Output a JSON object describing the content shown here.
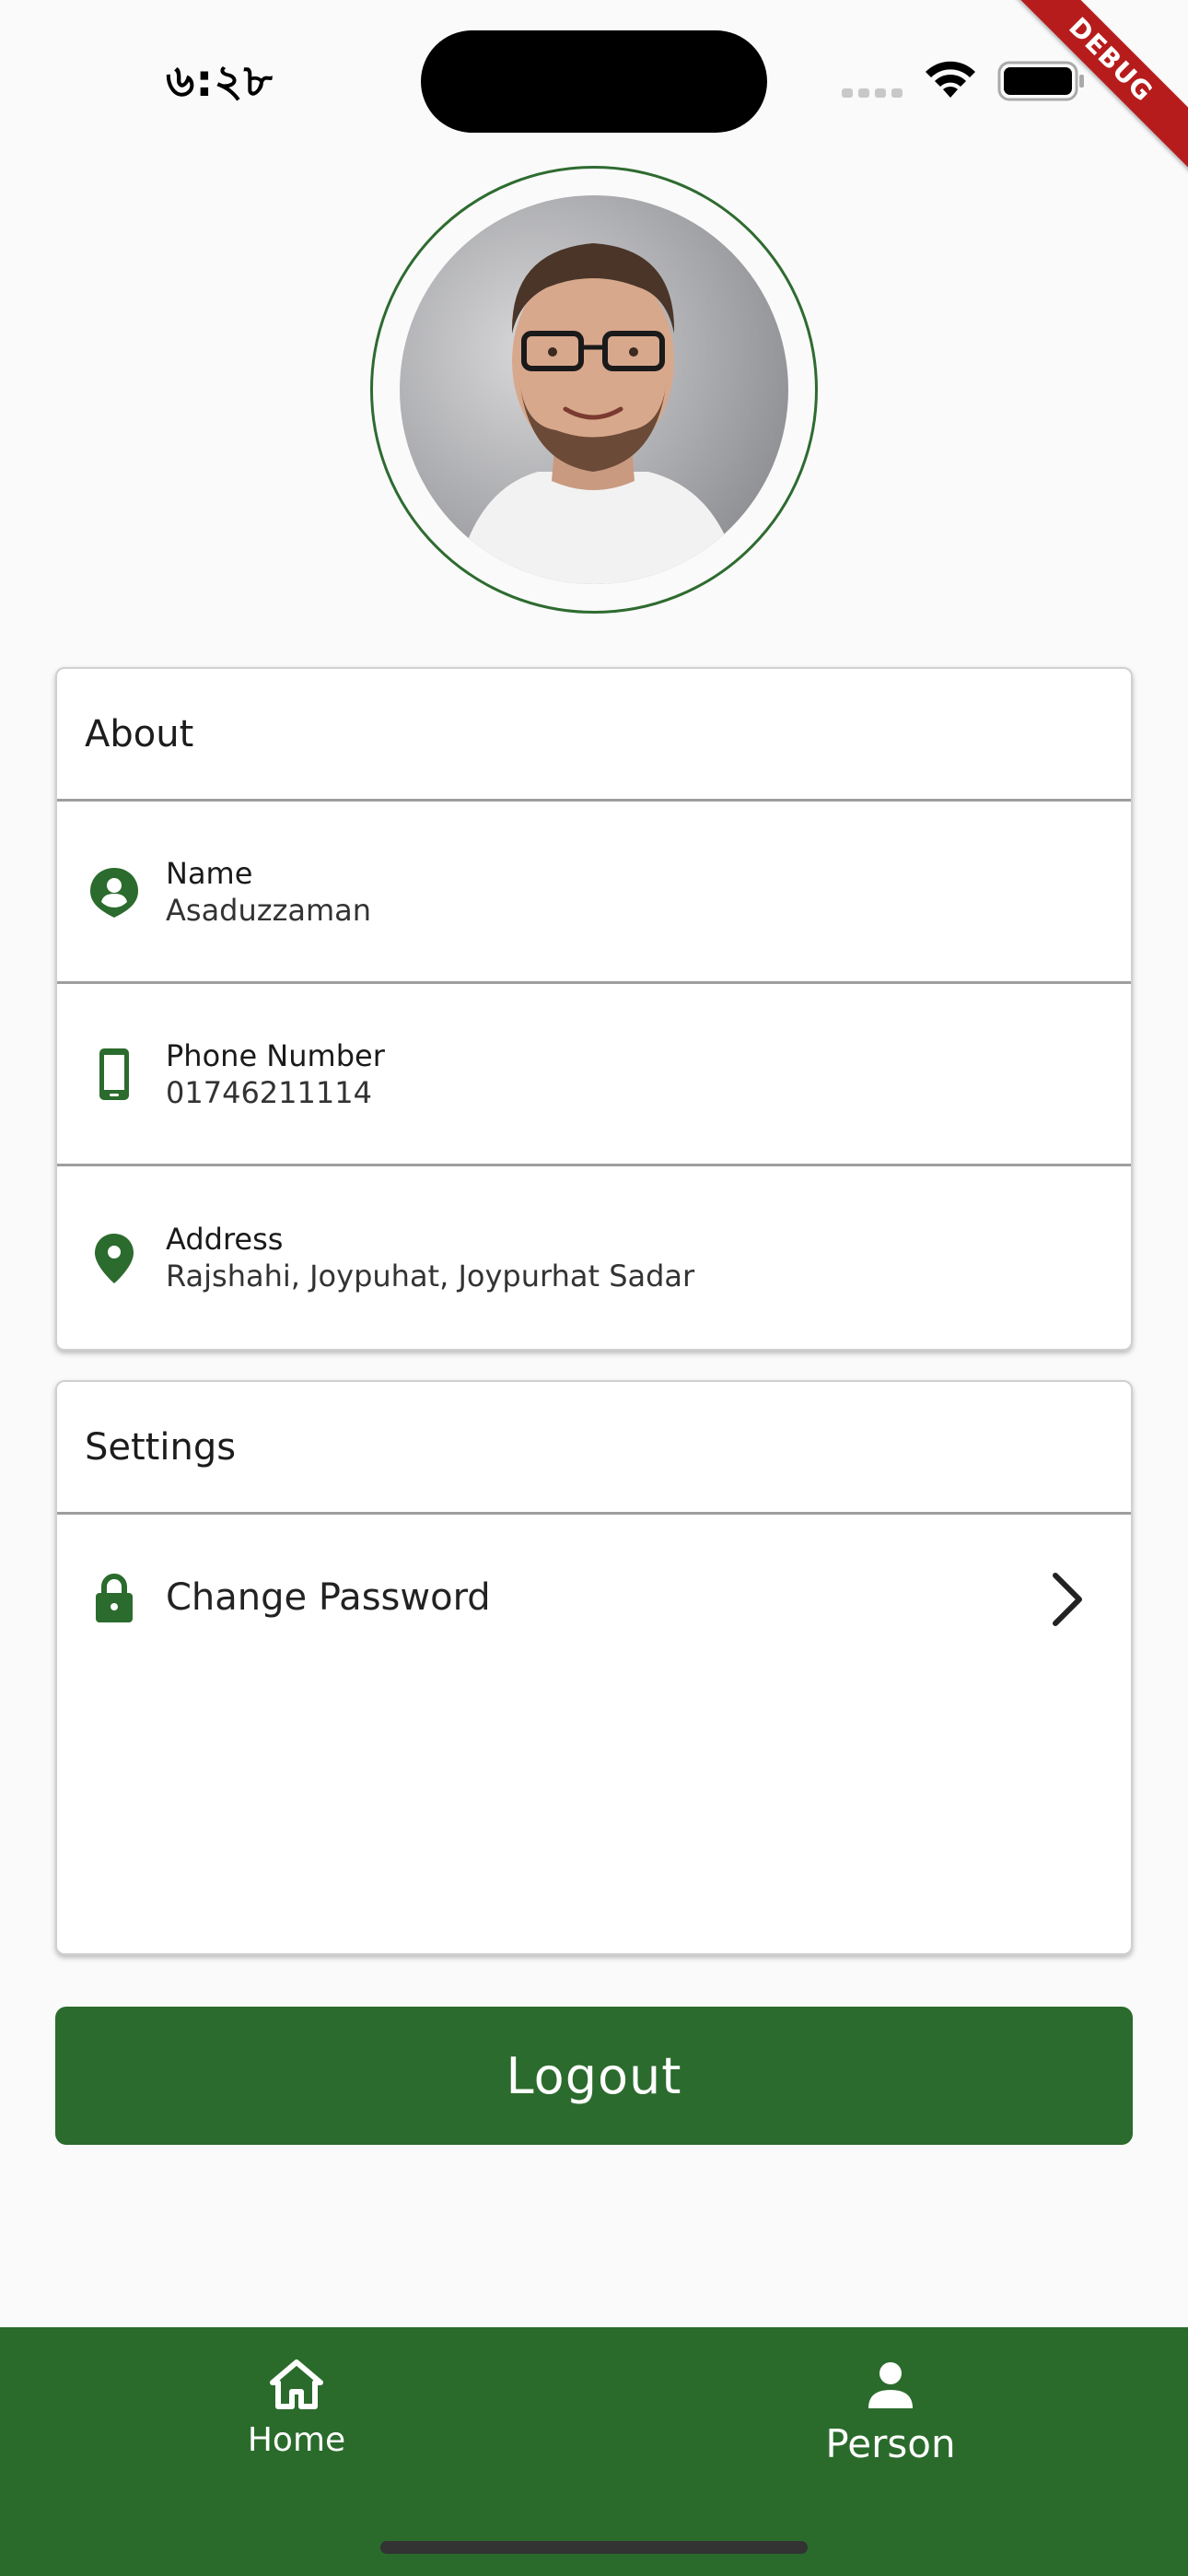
{
  "status_bar": {
    "time": "৬:২৮",
    "debug_label": "DEBUG"
  },
  "profile": {
    "avatar_alt": "profile photo"
  },
  "about": {
    "title": "About",
    "items": [
      {
        "icon": "person-pin-icon",
        "label": "Name",
        "value": "Asaduzzaman"
      },
      {
        "icon": "phone-icon",
        "label": "Phone Number",
        "value": "01746211114"
      },
      {
        "icon": "location-pin-icon",
        "label": "Address",
        "value": "Rajshahi, Joypuhat, Joypurhat Sadar"
      }
    ]
  },
  "settings": {
    "title": "Settings",
    "change_password_label": "Change Password"
  },
  "logout_label": "Logout",
  "bottom_nav": {
    "home_label": "Home",
    "person_label": "Person"
  },
  "colors": {
    "primary_green": "#2b6b2d",
    "background": "#fafafa",
    "debug_red": "#b71c1c"
  }
}
